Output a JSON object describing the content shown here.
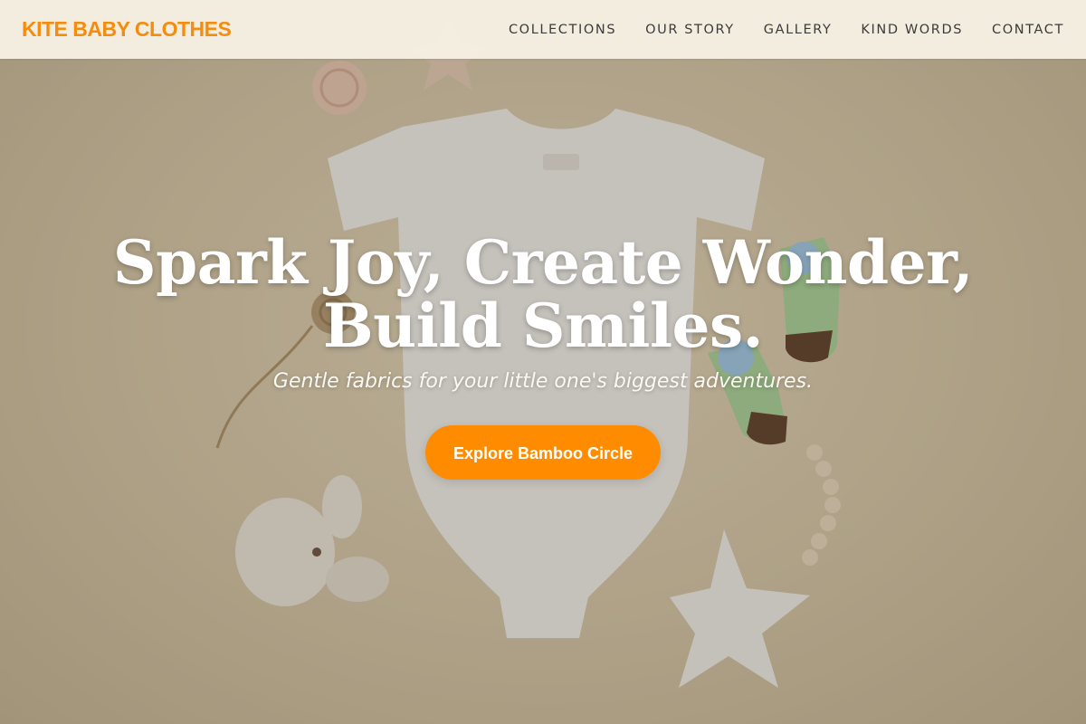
{
  "brand": {
    "name": "KITE BABY CLOTHES",
    "color": "#f48c0f"
  },
  "nav": {
    "items": [
      {
        "label": "COLLECTIONS"
      },
      {
        "label": "OUR STORY"
      },
      {
        "label": "GALLERY"
      },
      {
        "label": "KIND WORDS"
      },
      {
        "label": "CONTACT"
      }
    ]
  },
  "hero": {
    "headline": "Spark Joy, Create Wonder, Build Smiles.",
    "subheadline": "Gentle fabrics for your little one's biggest adventures.",
    "cta_label": "Explore Bamboo Circle",
    "cta_color": "#ff8c00",
    "background_description_icons": [
      "baby-onesie-icon",
      "plush-bunny-icon",
      "star-pillow-icon",
      "baby-socks-icon",
      "wooden-bead-teether-icon",
      "twine-spool-icon"
    ]
  }
}
